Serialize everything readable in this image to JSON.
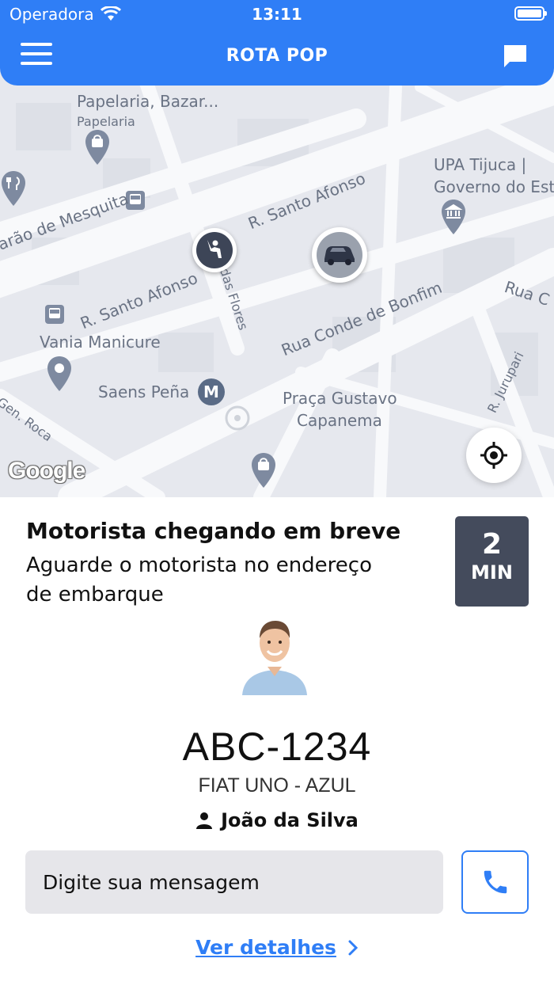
{
  "status_bar": {
    "carrier": "Operadora",
    "time": "13:11"
  },
  "header": {
    "title": "ROTA POP",
    "menu_icon": "hamburger-menu-icon",
    "chat_icon": "chat-bubble-icon"
  },
  "map": {
    "labels": {
      "papelaria_name": "Papelaria, Bazar...",
      "papelaria_type": "Papelaria",
      "upa_line1": "UPA Tijuca |",
      "upa_line2": "Governo do Est",
      "mesquita": "arão de Mesquita",
      "santo_afonso_top": "R. Santo Afonso",
      "santo_afonso_left": "R. Santo Afonso",
      "das_flores": "das Flores",
      "conde_bonfim": "Rua Conde de Bonfim",
      "rua_c": "Rua C",
      "vania": "Vania Manicure",
      "saens_pena": "Saens Peña",
      "praca_line1": "Praça Gustavo",
      "praca_line2": "Capanema",
      "jurupari": "R. Jurupari",
      "gen_roca": "Gen. Roca",
      "metro_badge": "M",
      "google": "Google"
    },
    "locate_icon": "locate-crosshair-icon",
    "user_marker_icon": "waving-person-icon",
    "car_marker_icon": "car-icon"
  },
  "ride": {
    "status_title": "Motorista chegando em breve",
    "status_subtitle": "Aguarde o motorista no endereço de embarque",
    "eta_value": "2",
    "eta_unit": "MIN",
    "plate": "ABC-1234",
    "car_model": "FIAT UNO - AZUL",
    "driver_name": "João da Silva",
    "message_placeholder": "Digite sua mensagem",
    "details_label": "Ver detalhes"
  },
  "colors": {
    "primary": "#2f7ef6",
    "eta_badge": "#444b5c",
    "map_background": "#e6e8ee"
  }
}
